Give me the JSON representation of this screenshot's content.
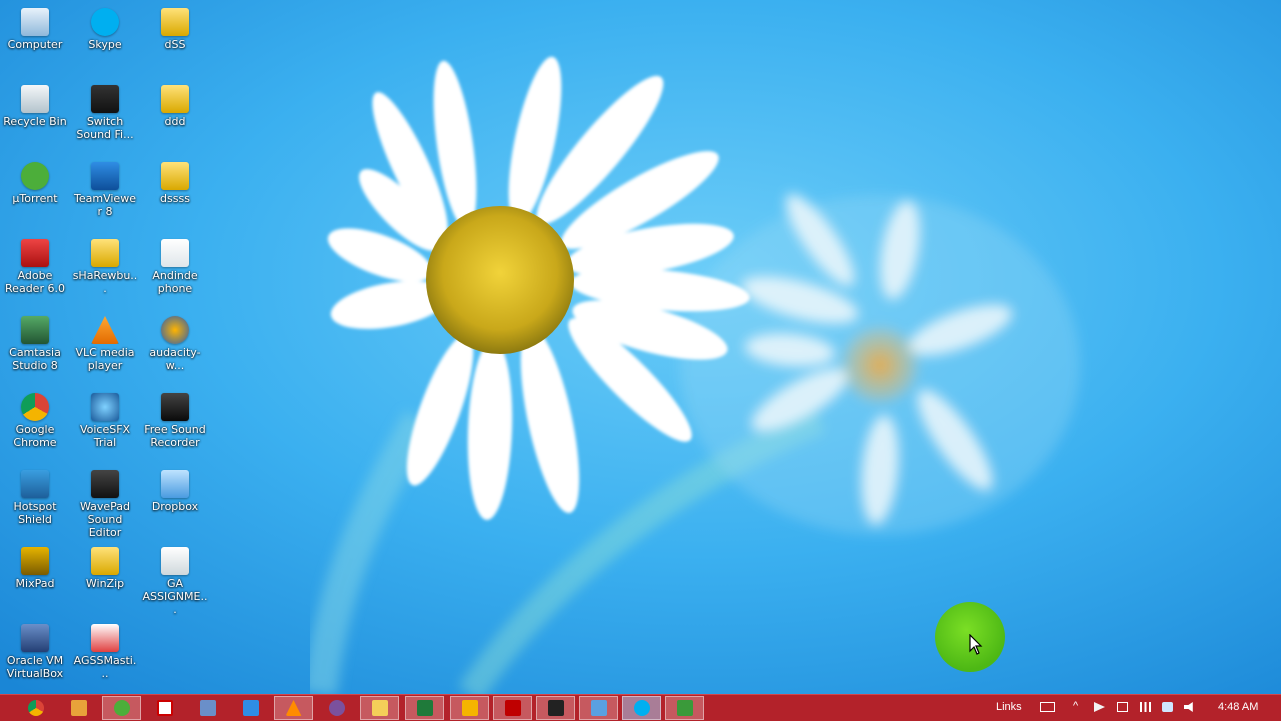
{
  "desktop": {
    "icons": [
      {
        "label": "Computer"
      },
      {
        "label": "Skype"
      },
      {
        "label": "dSS"
      },
      {
        "label": "Recycle Bin"
      },
      {
        "label": "Switch Sound Fi..."
      },
      {
        "label": "ddd"
      },
      {
        "label": "µTorrent"
      },
      {
        "label": "TeamViewer 8"
      },
      {
        "label": "dssss"
      },
      {
        "label": "Adobe Reader 6.0"
      },
      {
        "label": "sHaRewbu..."
      },
      {
        "label": "Andinde phone"
      },
      {
        "label": "Camtasia Studio 8"
      },
      {
        "label": "VLC media player"
      },
      {
        "label": "audacity-w..."
      },
      {
        "label": "Google Chrome"
      },
      {
        "label": "VoiceSFX Trial"
      },
      {
        "label": "Free Sound Recorder"
      },
      {
        "label": "Hotspot Shield"
      },
      {
        "label": "WavePad Sound Editor"
      },
      {
        "label": "Dropbox"
      },
      {
        "label": "MixPad"
      },
      {
        "label": "WinZip"
      },
      {
        "label": "GA ASSIGNME..."
      },
      {
        "label": "Oracle VM VirtualBox"
      },
      {
        "label": "AGSSMasti..."
      }
    ]
  },
  "taskbar": {
    "links_label": "Links",
    "clock": "4:48 AM",
    "accent": "#b3222a",
    "apps": [
      {
        "name": "chrome"
      },
      {
        "name": "camtasia"
      },
      {
        "name": "utorrent"
      },
      {
        "name": "acrobat"
      },
      {
        "name": "virtualbox"
      },
      {
        "name": "teamviewer"
      },
      {
        "name": "vlc"
      },
      {
        "name": "viber"
      },
      {
        "name": "file-explorer"
      },
      {
        "name": "excel"
      },
      {
        "name": "media"
      },
      {
        "name": "filezilla"
      },
      {
        "name": "mixpad"
      },
      {
        "name": "display"
      },
      {
        "name": "skype"
      },
      {
        "name": "camtasia-recorder"
      }
    ]
  }
}
